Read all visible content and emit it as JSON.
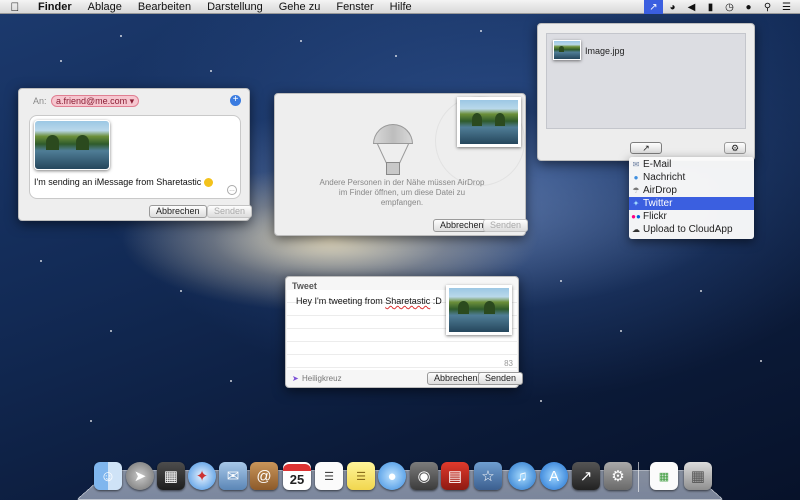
{
  "menubar": {
    "app": "Finder",
    "items": [
      "Ablage",
      "Bearbeiten",
      "Darstellung",
      "Gehe zu",
      "Fenster",
      "Hilfe"
    ],
    "status_icons": [
      "share-icon",
      "wifi-icon",
      "volume-icon",
      "battery-icon",
      "clock-icon",
      "user-icon",
      "spotlight-icon",
      "notification-center-icon"
    ]
  },
  "imessage": {
    "to_label": "An:",
    "recipient": "a.friend@me.com",
    "message": "I'm sending an iMessage from Sharetastic",
    "cancel": "Abbrechen",
    "send": "Senden"
  },
  "airdrop": {
    "text": "Andere Personen in der Nähe müssen AirDrop im Finder öffnen, um diese Datei zu empfangen.",
    "cancel": "Abbrechen",
    "send": "Senden"
  },
  "tweet": {
    "title": "Tweet",
    "text_before": "Hey I'm tweeting from ",
    "text_misspelled": "Sharetastic",
    "text_after": " :D",
    "count": "83",
    "location": "Heiligkreuz",
    "cancel": "Abbrechen",
    "send": "Senden"
  },
  "file_panel": {
    "filename": "Image.jpg"
  },
  "share_menu": {
    "items": [
      {
        "label": "E-Mail",
        "icon": "mail-icon",
        "selected": false
      },
      {
        "label": "Nachricht",
        "icon": "messages-icon",
        "selected": false
      },
      {
        "label": "AirDrop",
        "icon": "airdrop-icon",
        "selected": false
      },
      {
        "label": "Twitter",
        "icon": "twitter-icon",
        "selected": true
      },
      {
        "label": "Flickr",
        "icon": "flickr-icon",
        "selected": false
      },
      {
        "label": "Upload to CloudApp",
        "icon": "cloudapp-icon",
        "selected": false
      }
    ]
  },
  "dock": {
    "apps": [
      "Finder",
      "Launchpad",
      "Mission Control",
      "Safari",
      "Mail",
      "Contacts",
      "Calendar",
      "Reminders",
      "Notes",
      "Messages",
      "FaceTime",
      "Photo Booth",
      "iPhoto",
      "iTunes",
      "App Store",
      "Sharetastic",
      "System Preferences",
      "Preview",
      "Trash"
    ],
    "calendar_day": "25"
  },
  "colors": {
    "selection": "#3b5fe0",
    "recipient_pill": "#f6c6cf",
    "twitter": "#4fb8f0"
  }
}
